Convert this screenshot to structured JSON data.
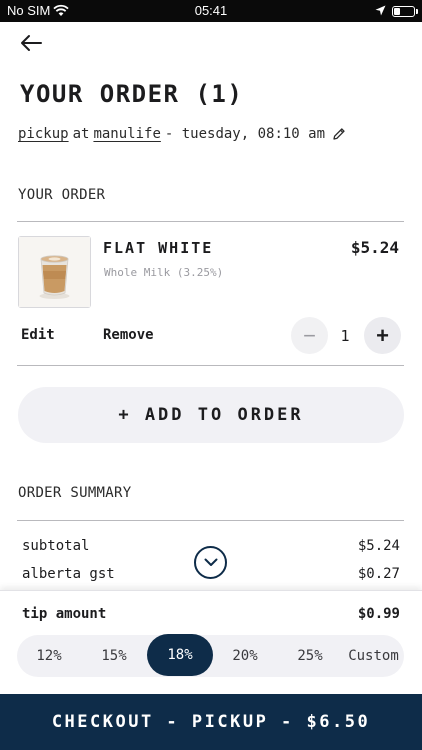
{
  "status_bar": {
    "carrier": "No SIM",
    "time": "05:41"
  },
  "page": {
    "title": "YOUR ORDER (1)"
  },
  "order_info": {
    "mode": "pickup",
    "at_text": "at",
    "location": "manulife",
    "when": "- tuesday, 08:10 am"
  },
  "order_section": {
    "label": "YOUR ORDER"
  },
  "item": {
    "name": "FLAT WHITE",
    "modifier": "Whole Milk (3.25%)",
    "price": "$5.24",
    "edit_label": "Edit",
    "remove_label": "Remove",
    "quantity": "1",
    "minus_symbol": "−",
    "plus_symbol": "+"
  },
  "add_to_order": {
    "label": "+ ADD TO ORDER"
  },
  "summary": {
    "label": "ORDER SUMMARY",
    "rows": [
      {
        "label": "subtotal",
        "value": "$5.24"
      },
      {
        "label": "alberta gst",
        "value": "$0.27"
      }
    ]
  },
  "tip": {
    "label": "tip amount",
    "value": "$0.99",
    "options": [
      "12%",
      "15%",
      "18%",
      "20%",
      "25%",
      "Custom"
    ],
    "selected": "18%"
  },
  "checkout": {
    "label": "CHECKOUT - PICKUP - $6.50"
  },
  "colors": {
    "accent": "#0e2c49",
    "pill_bg": "#f1f1f5"
  },
  "icons": [
    "wifi-icon",
    "location-arrow-icon",
    "battery-icon",
    "back-arrow-icon",
    "pencil-icon",
    "chevron-down-icon",
    "coffee-cup-image"
  ]
}
